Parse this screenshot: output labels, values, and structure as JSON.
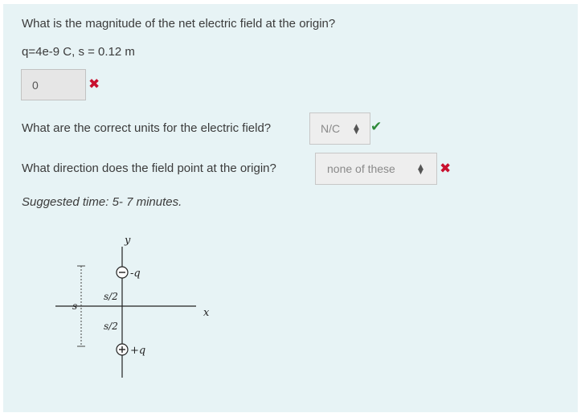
{
  "question": {
    "prompt": "What is the magnitude of the net electric field at the origin?",
    "given": "q=4e-9 C, s = 0.12 m",
    "answer_value": "0",
    "answer_status": "incorrect"
  },
  "units_question": {
    "prompt": "What are the correct units for the electric field?",
    "selected": "N/C",
    "status": "correct"
  },
  "direction_question": {
    "prompt": "What direction does the field point at the origin?",
    "selected": "none of these",
    "status": "incorrect"
  },
  "suggested_time": "Suggested time: 5- 7 minutes.",
  "diagram": {
    "y_label": "y",
    "x_label": "x",
    "top_charge_sign": "−",
    "top_charge_label": "-q",
    "bottom_charge_sign": "+",
    "bottom_charge_label": "+q",
    "upper_spacing_label": "s/2",
    "lower_spacing_label": "s/2",
    "total_spacing_label": "s"
  },
  "colors": {
    "incorrect": "#c8102e",
    "correct": "#2e8a3a",
    "panel_background": "#e7f3f5"
  }
}
